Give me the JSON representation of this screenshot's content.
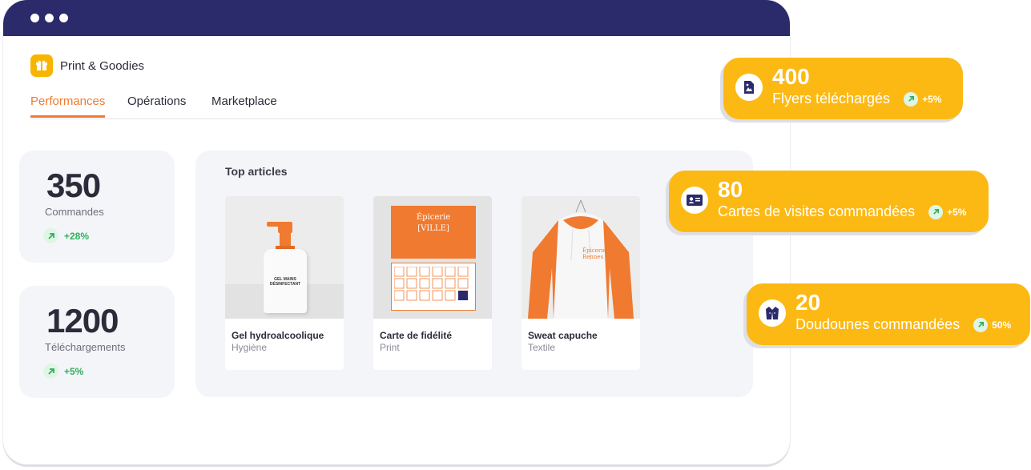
{
  "window": {
    "dots": 3
  },
  "brand": {
    "name": "Print & Goodies",
    "icon": "gift-icon",
    "color": "#f8b500"
  },
  "tabs": [
    {
      "label": "Performances",
      "active": true
    },
    {
      "label": "Opérations",
      "active": false
    },
    {
      "label": "Marketplace",
      "active": false
    }
  ],
  "stats": [
    {
      "value": "350",
      "label": "Commandes",
      "trend": "+28%",
      "trend_icon": "arrow-up-right-icon"
    },
    {
      "value": "1200",
      "label": "Téléchargements",
      "trend": "+5%",
      "trend_icon": "arrow-up-right-icon"
    }
  ],
  "top_articles": {
    "title": "Top articles",
    "items": [
      {
        "name": "Gel hydroalcoolique",
        "category": "Hygiène",
        "image_text": [
          "GEL MAINS",
          "DÉSINFECTANT"
        ]
      },
      {
        "name": "Carte de fidélité",
        "category": "Print",
        "image_text": [
          "Épicerie",
          "[VILLE]"
        ]
      },
      {
        "name": "Sweat capuche",
        "category": "Textile",
        "image_text": [
          "Épicerie",
          "Rennes"
        ]
      }
    ]
  },
  "highlights": [
    {
      "value": "400",
      "label": "Flyers téléchargés",
      "trend": "+5%",
      "icon": "flyer-icon"
    },
    {
      "value": "80",
      "label": "Cartes de visites commandées",
      "trend": "+5%",
      "icon": "business-card-icon"
    },
    {
      "value": "20",
      "label": "Doudounes commandées",
      "trend": "50%",
      "icon": "vest-icon"
    }
  ],
  "colors": {
    "accent": "#f07a30",
    "titlebar": "#2b2a6b",
    "highlight": "#fdb913",
    "positive": "#2fb05c"
  }
}
